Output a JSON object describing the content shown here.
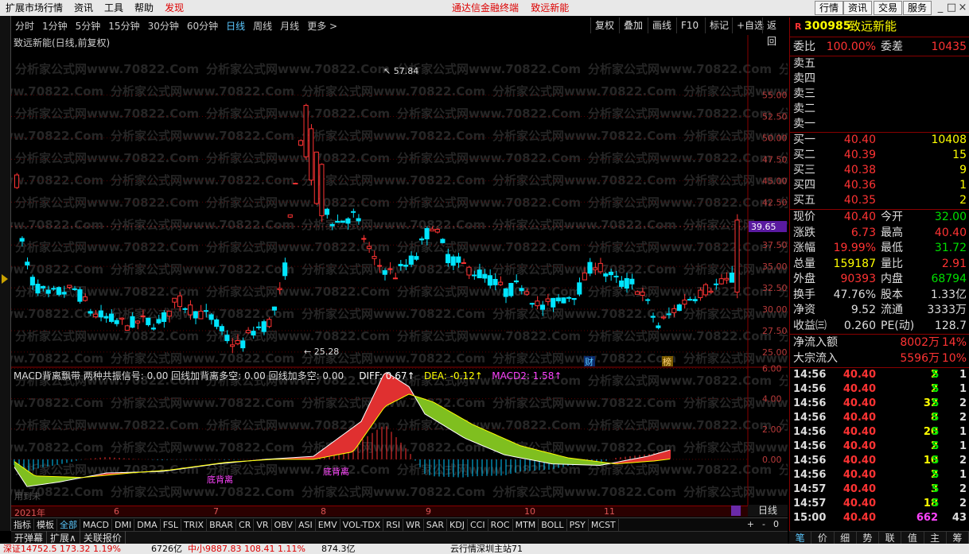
{
  "menu": {
    "items": [
      "扩展市场行情",
      "资讯",
      "工具",
      "帮助"
    ],
    "discover": "发现",
    "ads": [
      "通达信金融终端",
      "致远新能"
    ],
    "right_buttons": [
      "行情",
      "资讯",
      "交易",
      "服务"
    ],
    "win_buttons": [
      "_",
      "□",
      "×"
    ]
  },
  "toolbar": {
    "periods": [
      "分时",
      "1分钟",
      "5分钟",
      "15分钟",
      "30分钟",
      "60分钟",
      "日线",
      "周线",
      "月线",
      "更多 >"
    ],
    "active": "日线",
    "right": [
      "复权",
      "叠加",
      "画线",
      "F10",
      "标记",
      "+自选",
      "返回"
    ]
  },
  "chart_title": "致远新能(日线,前复权)",
  "chart_data": {
    "type": "candlestick",
    "ylim": [
      23.6,
      59.6
    ],
    "yticks": [
      55.0,
      52.5,
      50.0,
      47.5,
      45.0,
      42.5,
      37.5,
      35.0,
      32.5,
      30.0,
      27.5,
      25.0
    ],
    "current_price_label": "39.65",
    "annotations": [
      {
        "text": "57.84"
      },
      {
        "text": "25.28"
      }
    ],
    "markers": [
      "财",
      "榜"
    ],
    "months": [
      "2021年",
      "6",
      "7",
      "8",
      "9",
      "10",
      "11"
    ]
  },
  "candles_stat": {
    "up_color": "#ff3333",
    "down_color": "#00e5ff"
  },
  "macd": {
    "title": "MACD背离飘带  两种共振信号: 0.00  回线加背离多空: 0.00  回线加多空: 0.00",
    "diff": "DIFF: 0.67↑",
    "dea": "DEA: -0.12↑",
    "macd2": "MACD2: 1.58↑",
    "yticks": [
      "6.00",
      "4.00",
      "2.00",
      "0.00"
    ],
    "labels": [
      "底背离",
      "底背离"
    ],
    "footer": "用到未"
  },
  "periodlabel": "日线",
  "bottom_tabs": [
    "指标",
    "模板",
    "全部",
    "MACD",
    "DMI",
    "DMA",
    "FSL",
    "TRIX",
    "BRAR",
    "CR",
    "VR",
    "OBV",
    "ASI",
    "EMV",
    "VOL-TDX",
    "RSI",
    "WR",
    "SAR",
    "KDJ",
    "CCI",
    "ROC",
    "MTM",
    "BOLL",
    "PSY",
    "MCST"
  ],
  "bottom_controls": [
    "+",
    "-",
    "0"
  ],
  "row2": [
    "开弹幕",
    "扩展∧",
    "关联报价"
  ],
  "stock": {
    "flag": "R",
    "code": "300985",
    "name": "致远新能"
  },
  "ratio": {
    "lbl1": "委比",
    "v1": "100.00%",
    "lbl2": "委差",
    "v2": "10435"
  },
  "asks": [
    {
      "lbl": "卖五"
    },
    {
      "lbl": "卖四"
    },
    {
      "lbl": "卖三"
    },
    {
      "lbl": "卖二"
    },
    {
      "lbl": "卖一"
    }
  ],
  "bids": [
    {
      "lbl": "买一",
      "price": "40.40",
      "vol": "10408"
    },
    {
      "lbl": "买二",
      "price": "40.39",
      "vol": "15"
    },
    {
      "lbl": "买三",
      "price": "40.38",
      "vol": "9"
    },
    {
      "lbl": "买四",
      "price": "40.36",
      "vol": "1"
    },
    {
      "lbl": "买五",
      "price": "40.35",
      "vol": "2"
    }
  ],
  "quote": [
    {
      "l1": "现价",
      "v1": "40.40",
      "c1": "#ff3333",
      "l2": "今开",
      "v2": "32.00",
      "c2": "#00e000"
    },
    {
      "l1": "涨跌",
      "v1": "6.73",
      "c1": "#ff3333",
      "l2": "最高",
      "v2": "40.40",
      "c2": "#ff3333"
    },
    {
      "l1": "涨幅",
      "v1": "19.99%",
      "c1": "#ff3333",
      "l2": "最低",
      "v2": "31.72",
      "c2": "#00e000"
    },
    {
      "l1": "总量",
      "v1": "159187",
      "c1": "#ffff00",
      "l2": "量比",
      "v2": "2.91",
      "c2": "#ff3333"
    },
    {
      "l1": "外盘",
      "v1": "90393",
      "c1": "#ff3333",
      "l2": "内盘",
      "v2": "68794",
      "c2": "#00e000"
    },
    {
      "l1": "换手",
      "v1": "47.76%",
      "c1": "#ddd",
      "l2": "股本",
      "v2": "1.33亿",
      "c2": "#ddd"
    },
    {
      "l1": "净资",
      "v1": "9.52",
      "c1": "#ddd",
      "l2": "流通",
      "v2": "3333万",
      "c2": "#ddd"
    },
    {
      "l1": "收益㈢",
      "v1": "0.260",
      "c1": "#ddd",
      "l2": "PE(动)",
      "v2": "128.7",
      "c2": "#ddd"
    }
  ],
  "flows": [
    {
      "lbl": "净流入额",
      "val": "8002万",
      "pct": "14%"
    },
    {
      "lbl": "大宗流入",
      "val": "5596万",
      "pct": "10%"
    }
  ],
  "trades": [
    {
      "t": "14:56",
      "p": "40.40",
      "v": "2",
      "s": "S",
      "n": "1"
    },
    {
      "t": "14:56",
      "p": "40.40",
      "v": "2",
      "s": "S",
      "n": "1"
    },
    {
      "t": "14:56",
      "p": "40.40",
      "v": "32",
      "s": "S",
      "n": "2"
    },
    {
      "t": "14:56",
      "p": "40.40",
      "v": "8",
      "s": "S",
      "n": "2"
    },
    {
      "t": "14:56",
      "p": "40.40",
      "v": "20",
      "s": "S",
      "n": "1"
    },
    {
      "t": "14:56",
      "p": "40.40",
      "v": "2",
      "s": "S",
      "n": "1"
    },
    {
      "t": "14:56",
      "p": "40.40",
      "v": "10",
      "s": "S",
      "n": "2"
    },
    {
      "t": "14:56",
      "p": "40.40",
      "v": "2",
      "s": "S",
      "n": "1"
    },
    {
      "t": "14:57",
      "p": "40.40",
      "v": "3",
      "s": "S",
      "n": "2"
    },
    {
      "t": "14:57",
      "p": "40.40",
      "v": "18",
      "s": "S",
      "n": "2"
    },
    {
      "t": "15:00",
      "p": "40.40",
      "v": "662",
      "s": "",
      "n": "43"
    }
  ],
  "right_tabs": [
    "笔",
    "价",
    "细",
    "势",
    "联",
    "值",
    "主",
    "筹"
  ],
  "status": [
    "深证14752.5  173.32  1.19%",
    "6726亿",
    "中小9887.83  108.41  1.11%",
    "874.3亿",
    "云行情深圳主站71"
  ],
  "watermark": "分析家公式网www.70822.Com"
}
